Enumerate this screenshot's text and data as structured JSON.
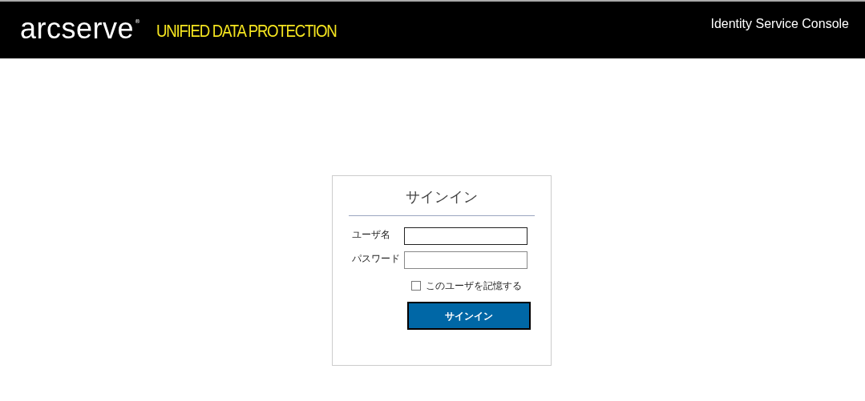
{
  "header": {
    "logo": "arcserve",
    "logo_mark": "®",
    "product": "UNIFIED DATA PROTECTION",
    "console_title": "Identity Service Console"
  },
  "sign_in": {
    "title": "サインイン",
    "fields": [
      {
        "label": "ユーザ名",
        "focused": true
      },
      {
        "label": "パスワード",
        "focused": false
      }
    ],
    "remember": {
      "label": "このユーザを記憶する",
      "checked": false
    },
    "button": "サインイン"
  }
}
